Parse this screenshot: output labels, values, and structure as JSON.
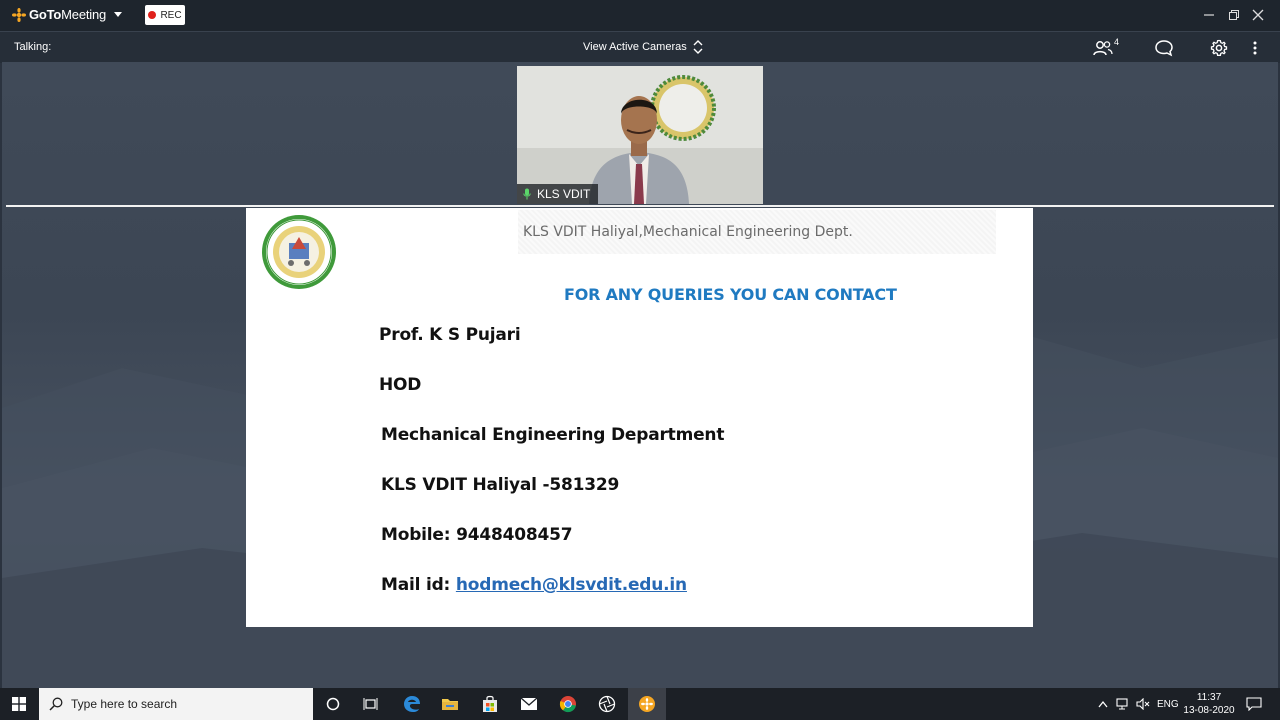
{
  "app": {
    "brand_name": "GoTo",
    "brand_suffix": "Meeting",
    "rec_label": "REC"
  },
  "toolbar": {
    "talking_label": "Talking:",
    "view_cameras_label": "View Active Cameras",
    "attendee_count": "4"
  },
  "camera": {
    "presenter_name": "KLS VDIT"
  },
  "slide": {
    "header": "KLS VDIT Haliyal,Mechanical Engineering Dept.",
    "title": "FOR ANY QUERIES YOU CAN CONTACT",
    "name": "Prof. K S Pujari",
    "role": "HOD",
    "department": "Mechanical Engineering Department",
    "address": "KLS VDIT Haliyal -581329",
    "mobile": "Mobile: 9448408457",
    "mail_prefix": "Mail id: ",
    "mail": "hodmech@klsvdit.edu.in"
  },
  "taskbar": {
    "search_placeholder": "Type here to search",
    "language": "ENG",
    "time": "11:37",
    "date": "13-08-2020"
  },
  "colors": {
    "accent_orange": "#f5a623",
    "slide_title_blue": "#1f7ac1",
    "link_blue": "#2769b5",
    "rec_red": "#e0201b"
  }
}
